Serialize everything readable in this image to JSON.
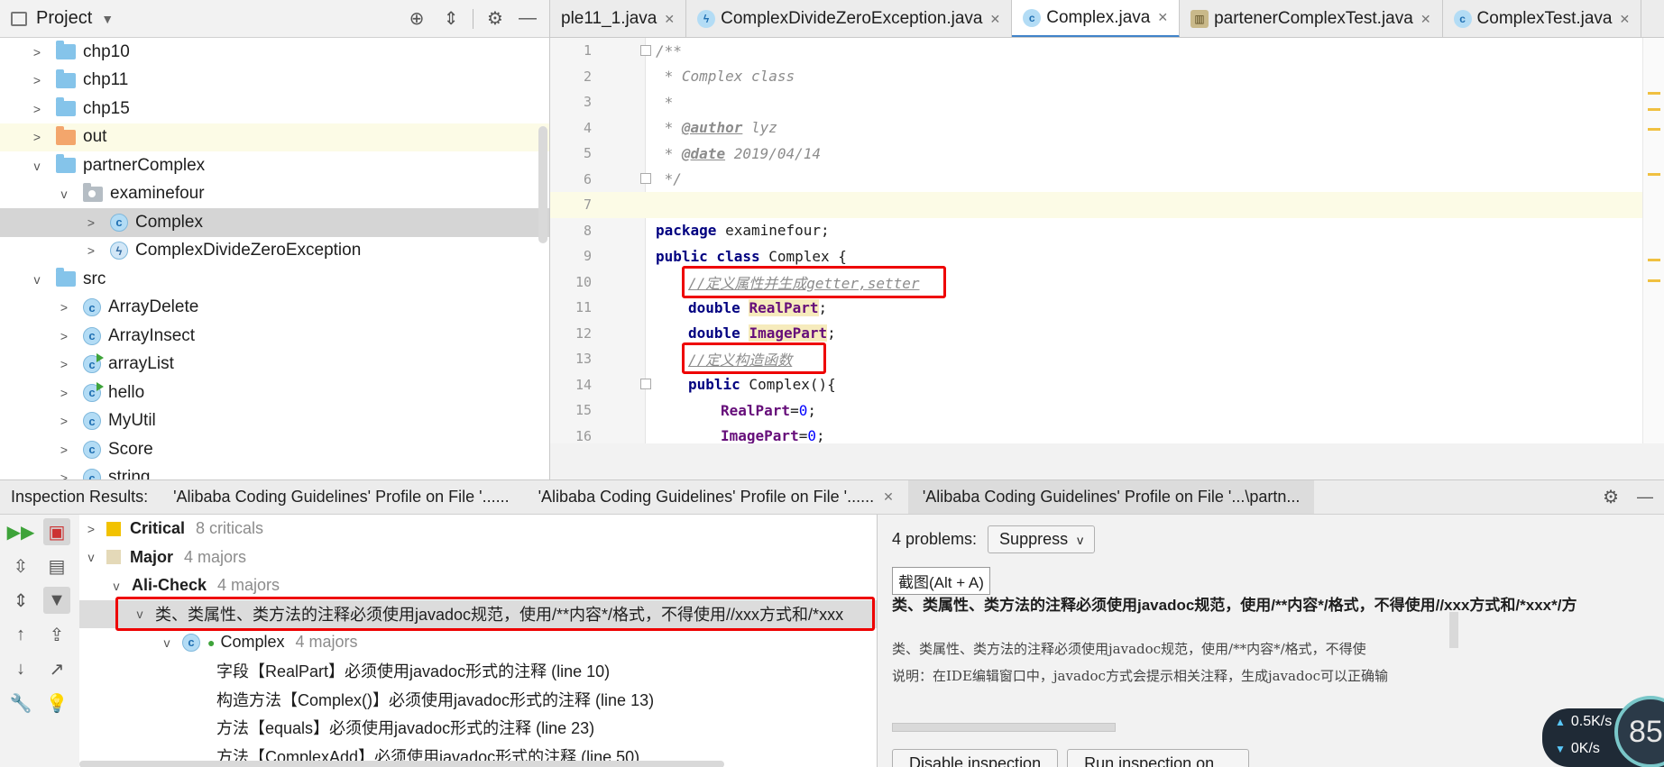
{
  "project": {
    "title": "Project",
    "tree": [
      {
        "label": "chp10",
        "kind": "folder"
      },
      {
        "label": "chp11",
        "kind": "folder"
      },
      {
        "label": "chp15",
        "kind": "folder"
      },
      {
        "label": "out",
        "kind": "folder-orange"
      },
      {
        "label": "partnerComplex",
        "kind": "folder"
      },
      {
        "label": "examinefour",
        "kind": "package"
      },
      {
        "label": "Complex",
        "kind": "class"
      },
      {
        "label": "ComplexDivideZeroException",
        "kind": "exception"
      },
      {
        "label": "src",
        "kind": "folder"
      },
      {
        "label": "ArrayDelete",
        "kind": "class"
      },
      {
        "label": "ArrayInsect",
        "kind": "class"
      },
      {
        "label": "arrayList",
        "kind": "class-run"
      },
      {
        "label": "hello",
        "kind": "class-run"
      },
      {
        "label": "MyUtil",
        "kind": "class"
      },
      {
        "label": "Score",
        "kind": "class"
      },
      {
        "label": "string",
        "kind": "class"
      }
    ]
  },
  "editor_tabs": [
    {
      "label": "ple11_1.java"
    },
    {
      "label": "ComplexDivideZeroException.java"
    },
    {
      "label": "Complex.java",
      "active": true
    },
    {
      "label": "partenerComplexTest.java"
    },
    {
      "label": "ComplexTest.java"
    }
  ],
  "code_lines": [
    {
      "n": "1",
      "text": "/**"
    },
    {
      "n": "2",
      "text": " * Complex class"
    },
    {
      "n": "3",
      "text": " *"
    },
    {
      "n": "4",
      "tag": "@author",
      "rest": " lyz"
    },
    {
      "n": "5",
      "tag": "@date",
      "rest": " 2019/04/14"
    },
    {
      "n": "6",
      "text": " */"
    },
    {
      "n": "7",
      "text": ""
    },
    {
      "n": "8",
      "kw": "package",
      "rest": " examinefour;"
    },
    {
      "n": "9",
      "kw": "public class",
      "rest": " Complex {"
    },
    {
      "n": "10",
      "comment": "//定义属性并生成getter,setter"
    },
    {
      "n": "11",
      "kw": "double",
      "field": "RealPart",
      "rest": ";"
    },
    {
      "n": "12",
      "kw": "double",
      "field": "ImagePart",
      "rest": ";"
    },
    {
      "n": "13",
      "comment": "//定义构造函数"
    },
    {
      "n": "14",
      "kw": "public",
      "rest": " Complex(){"
    },
    {
      "n": "15",
      "field": "RealPart",
      "rest": "=",
      "num": "0",
      "end": ";"
    },
    {
      "n": "16",
      "field": "ImagePart",
      "rest": "=",
      "num": "0",
      "end": ";"
    }
  ],
  "inspection": {
    "label": "Inspection Results:",
    "tabs": [
      {
        "label": "'Alibaba Coding Guidelines' Profile on File '......"
      },
      {
        "label": "'Alibaba Coding Guidelines' Profile on File '......"
      },
      {
        "label": "'Alibaba Coding Guidelines' Profile on File '...\\partn..."
      }
    ],
    "tree": {
      "critical": {
        "label": "Critical",
        "count": "8 criticals"
      },
      "major": {
        "label": "Major",
        "count": "4 majors"
      },
      "alicheck": {
        "label": "Ali-Check",
        "count": "4 majors"
      },
      "rule": {
        "label": "类、类属性、类方法的注释必须使用javadoc规范，使用/**内容*/格式，不得使用//xxx方式和/*xxx"
      },
      "complex": {
        "label": "Complex",
        "count": "4 majors"
      },
      "problems": [
        {
          "label": "字段【RealPart】必须使用javadoc形式的注释 (line 10)"
        },
        {
          "label": "构造方法【Complex()】必须使用javadoc形式的注释 (line 13)"
        },
        {
          "label": "方法【equals】必须使用javadoc形式的注释 (line 23)"
        },
        {
          "label": "方法【ComplexAdd】必须使用javadoc形式的注释 (line 50)"
        }
      ]
    },
    "detail": {
      "problems_label": "4 problems:",
      "suppress_label": "Suppress",
      "tooltip": "截图(Alt + A)",
      "rule_title": "类、类属性、类方法的注释必须使用javadoc规范，使用/**内容*/格式，不得使用//xxx方式和/*xxx*/方",
      "desc_line1": "类、类属性、类方法的注释必须使用javadoc规范，使用/**内容*/格式，不得使",
      "desc_line2": "说明：在IDE编辑窗口中，javadoc方式会提示相关注释，生成javadoc可以正确输",
      "disable_label": "Disable inspection",
      "run_label": "Run inspection on ..."
    }
  },
  "overlay": {
    "upload": "0.5K/s",
    "download": "0K/s",
    "gauge": "85"
  }
}
